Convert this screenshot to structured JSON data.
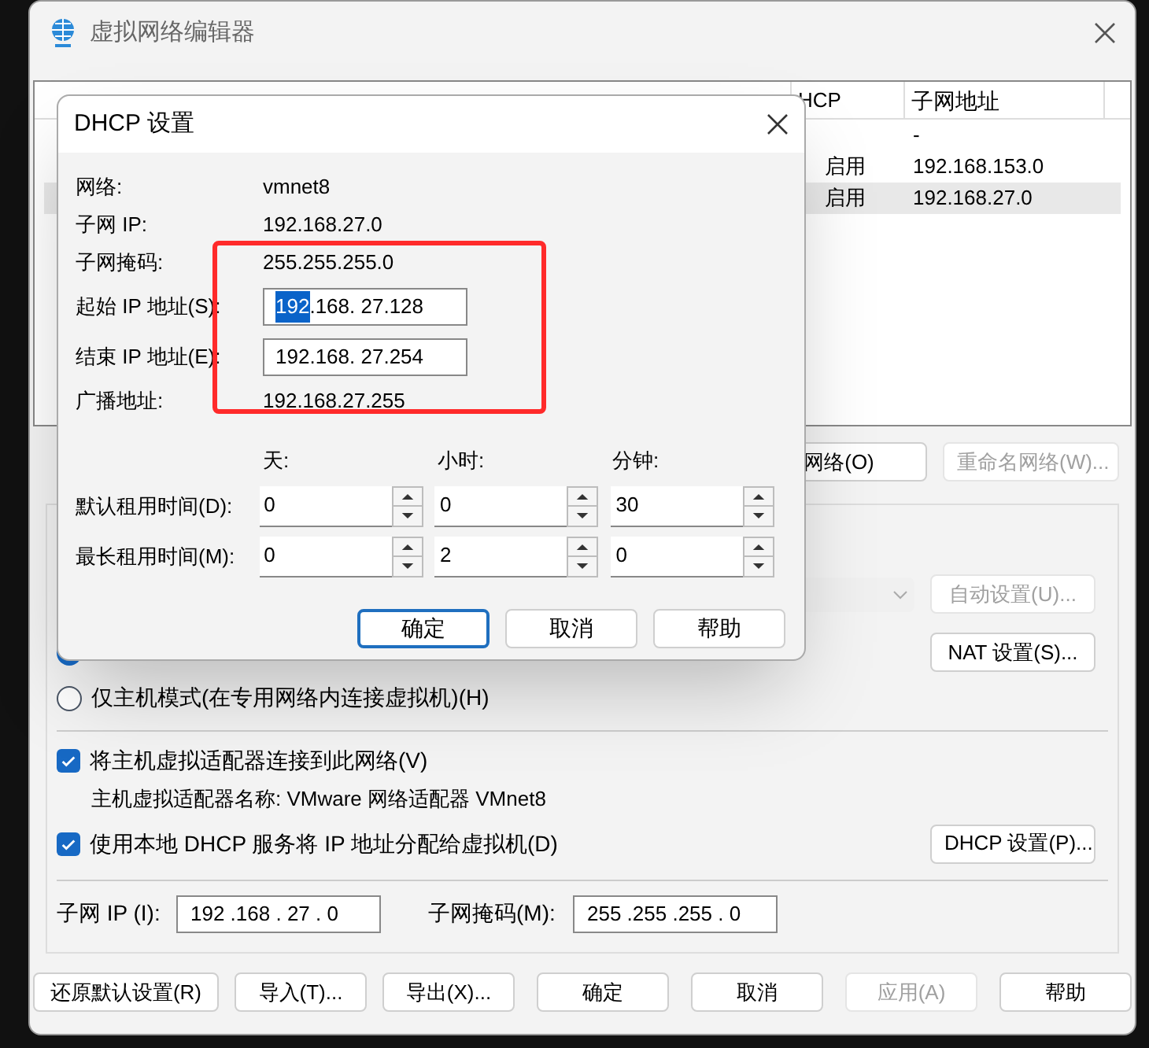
{
  "window": {
    "title": "虚拟网络编辑器"
  },
  "network_table": {
    "columns": [
      {
        "label": "HCP"
      },
      {
        "label": "子网地址"
      }
    ],
    "rows": [
      {
        "dhcp": "",
        "subnet": "-",
        "selected": false
      },
      {
        "dhcp": "启用",
        "subnet": "192.168.153.0",
        "selected": false
      },
      {
        "dhcp": "启用",
        "subnet": "192.168.27.0",
        "selected": true
      }
    ]
  },
  "network_buttons": [
    {
      "label": "网络(O)",
      "disabled": false
    },
    {
      "label": "重命名网络(W)...",
      "disabled": true
    }
  ],
  "vmnet_info": {
    "bridge_dropdown": {
      "disabled": true
    },
    "auto_button": {
      "label": "自动设置(U)...",
      "disabled": true
    },
    "nat_button": {
      "label": "NAT 设置(S)...",
      "disabled": false
    },
    "modes": [
      {
        "selected": true
      },
      {
        "label": "仅主机模式(在专用网络内连接虚拟机)(H)",
        "selected": false
      }
    ],
    "connect_adapter": {
      "label": "将主机虚拟适配器连接到此网络(V)",
      "checked": true
    },
    "adapter_name": "主机虚拟适配器名称: VMware 网络适配器 VMnet8",
    "use_dhcp": {
      "label": "使用本地 DHCP 服务将 IP 地址分配给虚拟机(D)",
      "checked": true
    },
    "dhcp_button": {
      "label": "DHCP 设置(P)..."
    },
    "subnet_ip": {
      "label": "子网 IP (I):",
      "value": "192 .168 . 27 . 0"
    },
    "subnet_mask": {
      "label": "子网掩码(M):",
      "value": "255 .255 .255 . 0"
    }
  },
  "footer_buttons": [
    {
      "label": "还原默认设置(R)",
      "disabled": false
    },
    {
      "label": "导入(T)...",
      "disabled": false
    },
    {
      "label": "导出(X)...",
      "disabled": false
    },
    {
      "label": "确定",
      "disabled": false
    },
    {
      "label": "取消",
      "disabled": false
    },
    {
      "label": "应用(A)",
      "disabled": true
    },
    {
      "label": "帮助",
      "disabled": false
    }
  ],
  "dhcp_dialog": {
    "title": "DHCP 设置",
    "info": [
      {
        "label": "网络:",
        "value": "vmnet8"
      },
      {
        "label": "子网 IP:",
        "value": "192.168.27.0"
      },
      {
        "label": "子网掩码:",
        "value": "255.255.255.0"
      }
    ],
    "ranges": [
      {
        "label": "起始 IP 地址(S):",
        "octets": [
          {
            "text": "192",
            "selected": true
          },
          {
            "text": ".168",
            "selected": false
          },
          {
            "text": ". 27",
            "selected": false
          },
          {
            "text": ".128",
            "selected": false
          }
        ]
      },
      {
        "label": "结束 IP 地址(E):",
        "octets": [
          {
            "text": "192",
            "selected": false
          },
          {
            "text": ".168",
            "selected": false
          },
          {
            "text": ". 27",
            "selected": false
          },
          {
            "text": ".254",
            "selected": false
          }
        ]
      }
    ],
    "broadcast": {
      "label": "广播地址:",
      "value": "192.168.27.255"
    },
    "lease_headers": [
      "天:",
      "小时:",
      "分钟:"
    ],
    "leases": [
      {
        "label": "默认租用时间(D):",
        "values": [
          "0",
          "0",
          "30"
        ]
      },
      {
        "label": "最长租用时间(M):",
        "values": [
          "0",
          "2",
          "0"
        ]
      }
    ],
    "buttons": [
      {
        "label": "确定",
        "default": true
      },
      {
        "label": "取消",
        "default": false
      },
      {
        "label": "帮助",
        "default": false
      }
    ]
  }
}
